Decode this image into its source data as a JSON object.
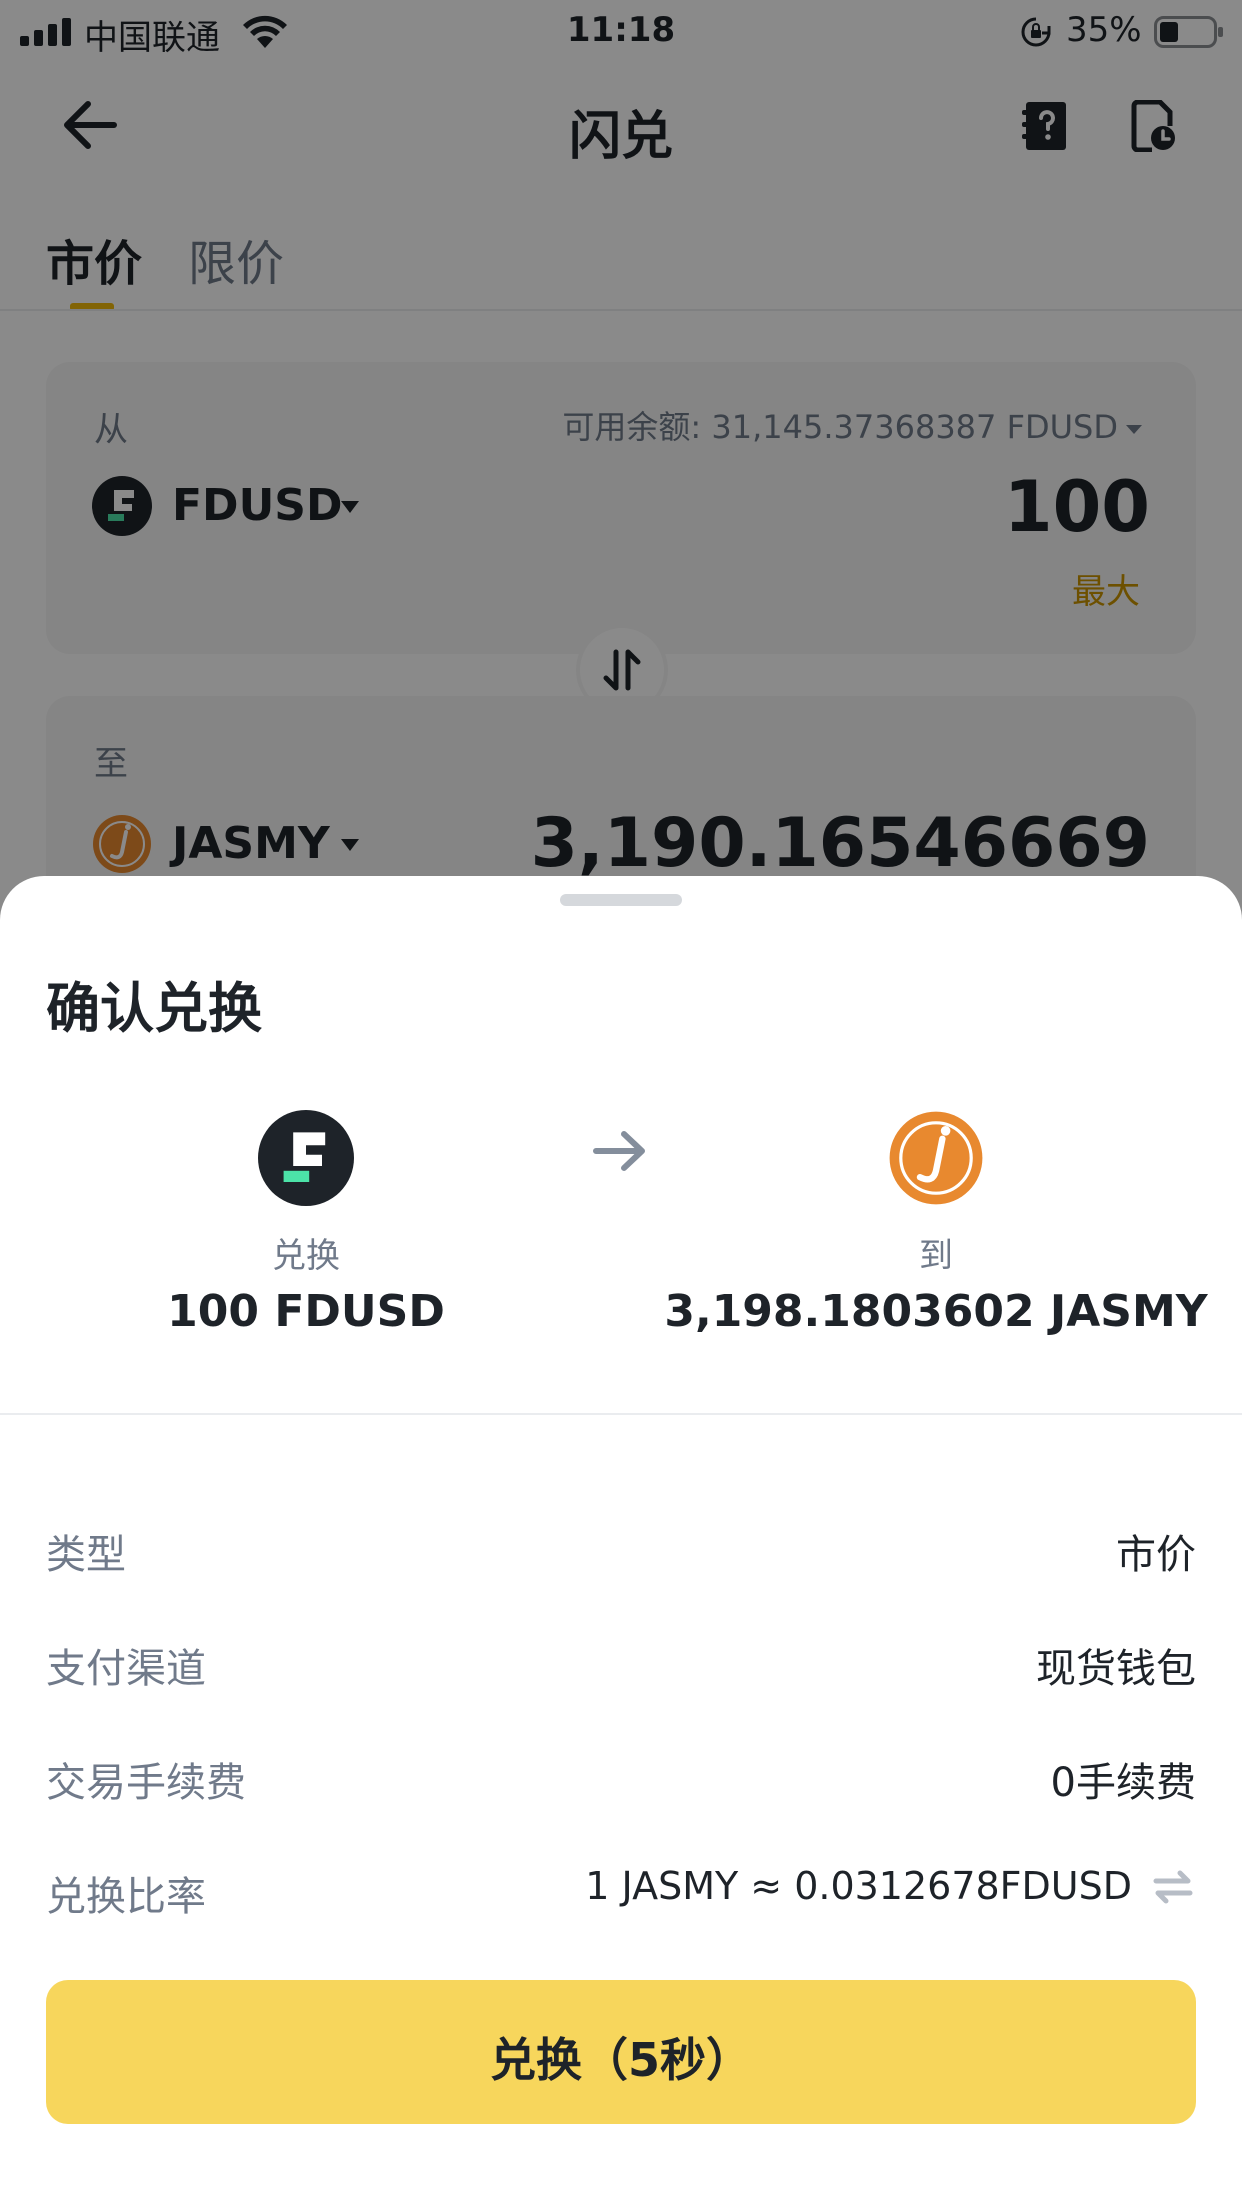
{
  "status_bar": {
    "carrier": "中国联通",
    "time": "11:18",
    "battery": "35%"
  },
  "nav": {
    "title": "闪兑"
  },
  "tabs": [
    {
      "label": "市价",
      "active": true
    },
    {
      "label": "限价",
      "active": false
    }
  ],
  "from_card": {
    "label": "从",
    "balance": "可用余额: 31,145.37368387 FDUSD",
    "coin": "FDUSD",
    "amount": "100",
    "max_label": "最大"
  },
  "to_card": {
    "label": "至",
    "coin": "JASMY",
    "amount": "3,190.16546669"
  },
  "sheet": {
    "title": "确认兑换",
    "from_label": "兑换",
    "from_amount": "100 FDUSD",
    "to_label": "到",
    "to_amount": "3,198.1803602 JASMY",
    "details": [
      {
        "label": "类型",
        "value": "市价"
      },
      {
        "label": "支付渠道",
        "value": "现货钱包"
      },
      {
        "label": "交易手续费",
        "value": "0手续费"
      },
      {
        "label": "兑换比率",
        "value": "1 JASMY ≈ 0.0312678FDUSD"
      }
    ],
    "confirm_label": "兑换（5秒）"
  },
  "colors": {
    "accent": "#F0B90B",
    "confirm_button": "#F7D65C",
    "max_text": "#C99400",
    "jasmy_orange": "#E8892F",
    "fdusd_green": "#4CE3A8"
  },
  "icons": {
    "back": "arrow-left-icon",
    "help": "book-question-icon",
    "history": "order-history-icon",
    "swap": "swap-vertical-icon",
    "convert_arrow": "arrow-right-icon",
    "rate_switch": "switch-arrows-icon"
  }
}
